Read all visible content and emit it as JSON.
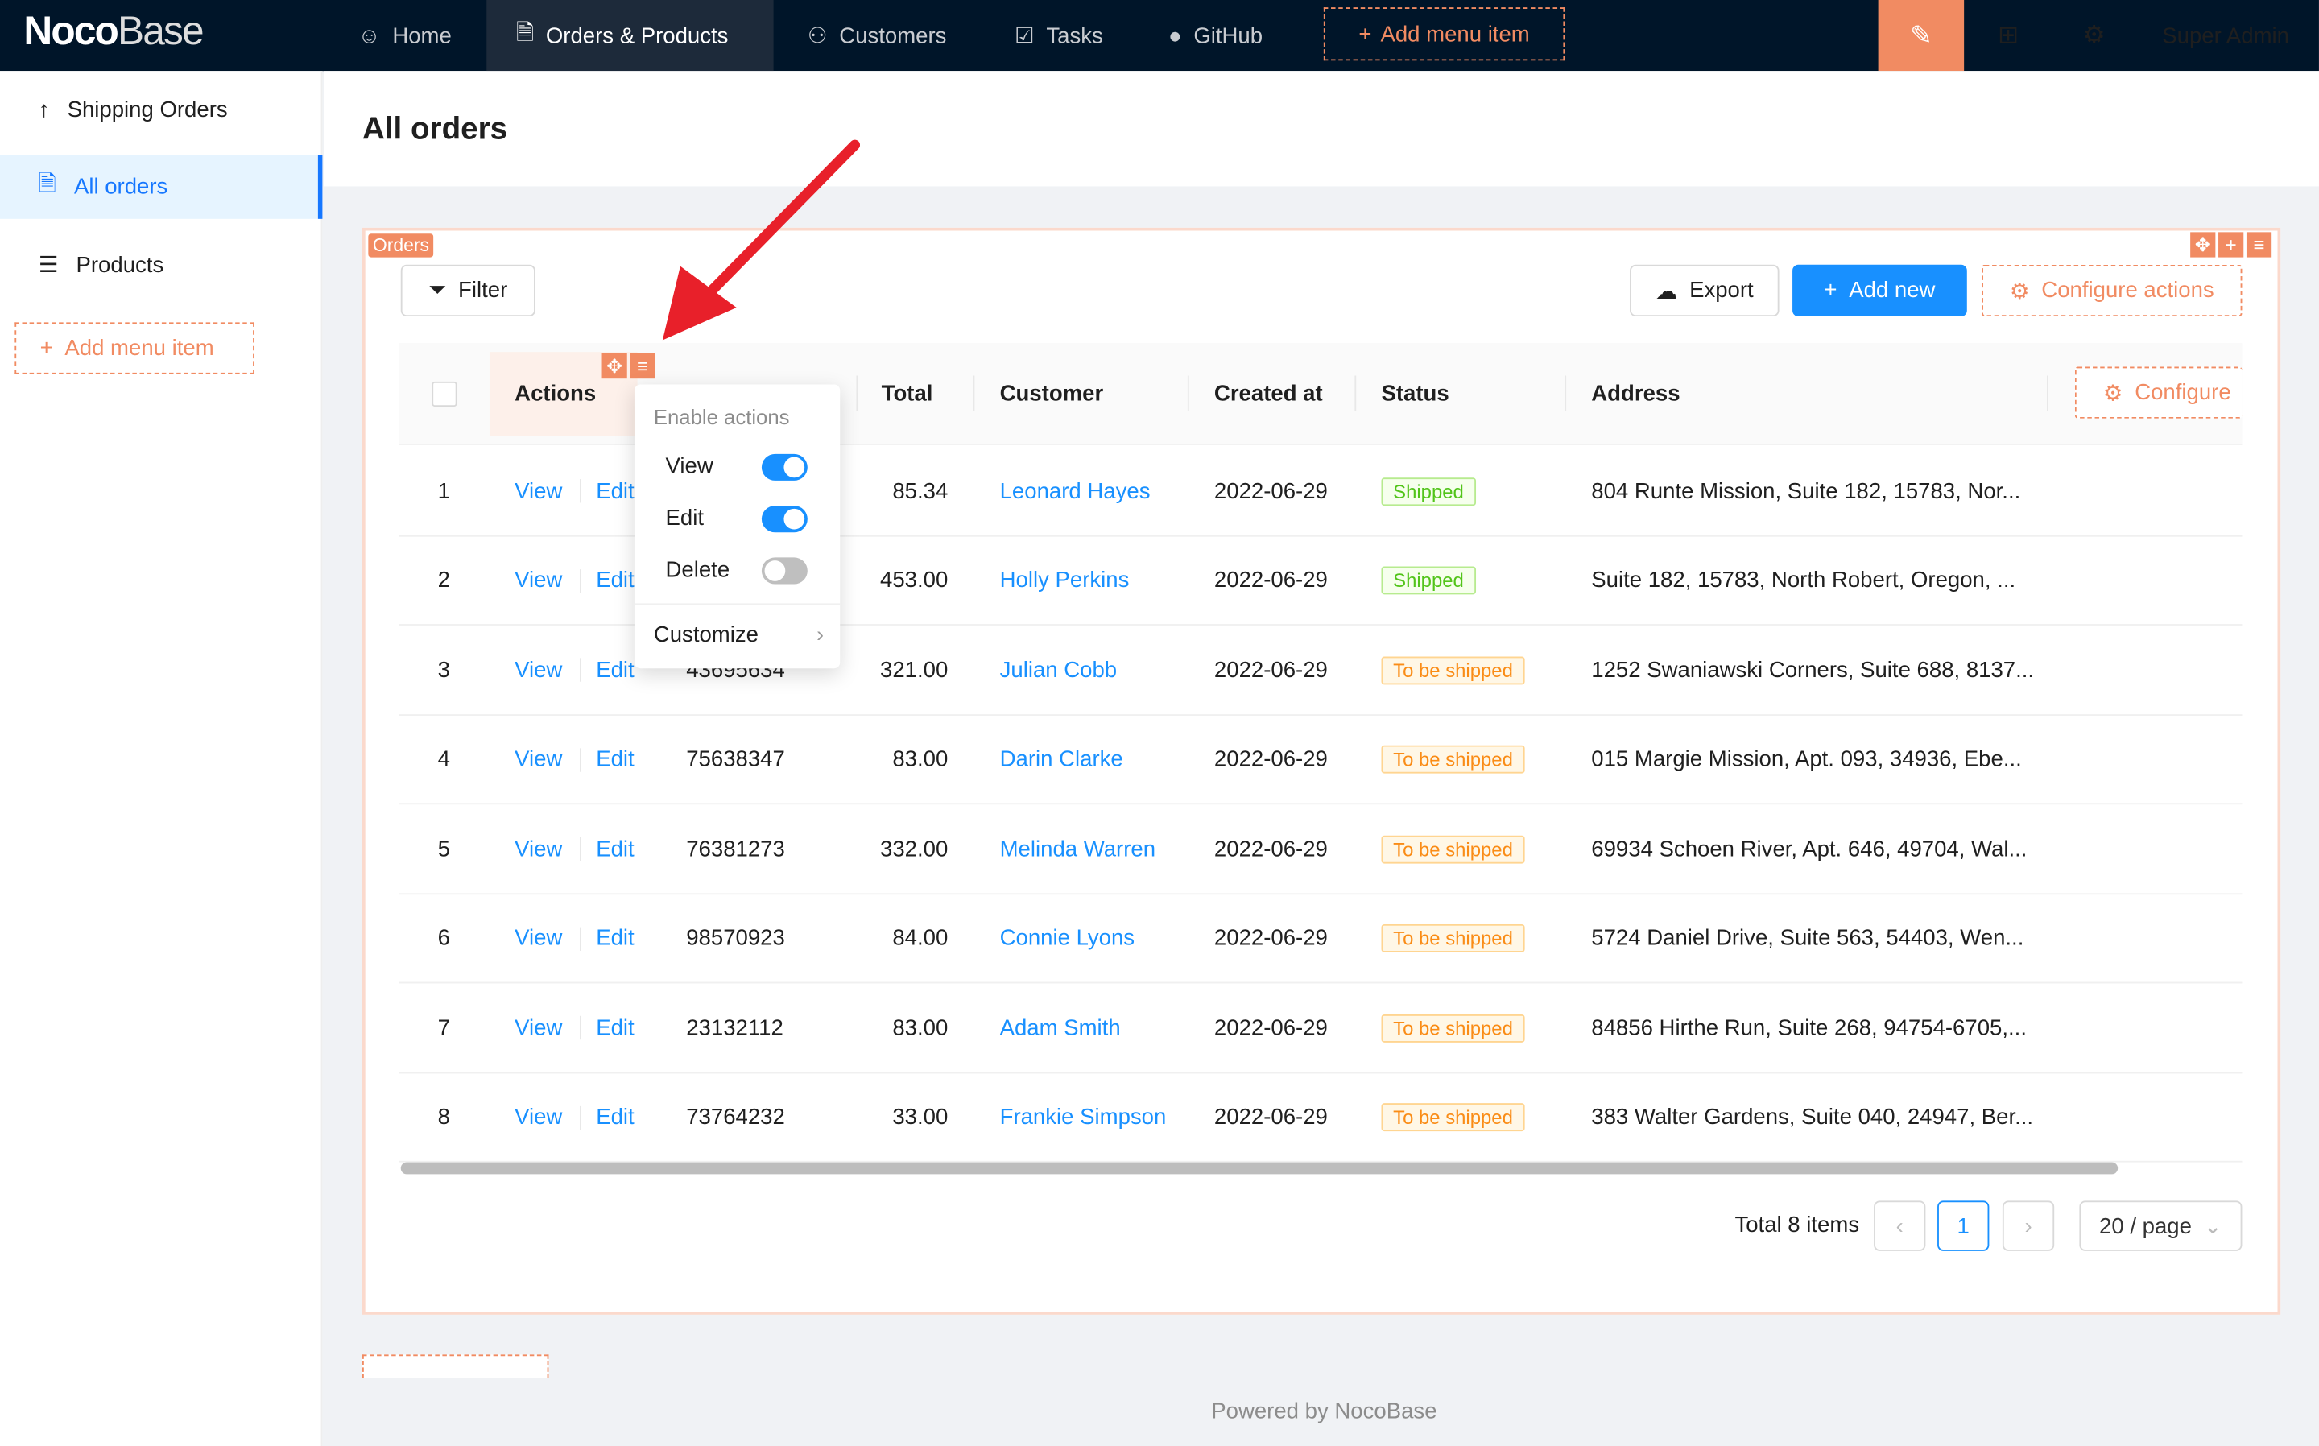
{
  "topbar": {
    "logo_bold": "Noco",
    "logo_light": "Base",
    "nav": [
      {
        "label": "Home",
        "icon": "smile-icon"
      },
      {
        "label": "Orders & Products",
        "icon": "file-check-icon",
        "active": true
      },
      {
        "label": "Customers",
        "icon": "users-icon"
      },
      {
        "label": "Tasks",
        "icon": "checkbox-icon"
      },
      {
        "label": "GitHub",
        "icon": "github-icon"
      }
    ],
    "add_menu_item": "Add menu item",
    "user": "Super Admin"
  },
  "sidebar": {
    "items": [
      {
        "label": "Shipping Orders"
      },
      {
        "label": "All orders",
        "active": true
      },
      {
        "label": "Products"
      }
    ],
    "add_menu_item": "Add menu item"
  },
  "page": {
    "title": "All orders"
  },
  "block": {
    "tag": "Orders",
    "filter": "Filter",
    "export": "Export",
    "add_new": "Add new",
    "configure_actions": "Configure actions",
    "configure_columns": "Configure"
  },
  "table": {
    "headers": {
      "actions": "Actions",
      "total": "Total",
      "customer": "Customer",
      "created": "Created at",
      "status": "Status",
      "address": "Address"
    },
    "rows": [
      {
        "n": "1",
        "view": "View",
        "edit": "Edit",
        "order": "",
        "total": "85.34",
        "customer": "Leonard Hayes",
        "created": "2022-06-29",
        "status": "Shipped",
        "address": "804 Runte Mission, Suite 182, 15783, Nor..."
      },
      {
        "n": "2",
        "view": "View",
        "edit": "Edit",
        "order": "",
        "total": "453.00",
        "customer": "Holly Perkins",
        "created": "2022-06-29",
        "status": "Shipped",
        "address": "Suite 182, 15783, North Robert, Oregon, ..."
      },
      {
        "n": "3",
        "view": "View",
        "edit": "Edit",
        "order": "43695634",
        "total": "321.00",
        "customer": "Julian Cobb",
        "created": "2022-06-29",
        "status": "To be shipped",
        "address": "1252 Swaniawski Corners, Suite 688, 8137..."
      },
      {
        "n": "4",
        "view": "View",
        "edit": "Edit",
        "order": "75638347",
        "total": "83.00",
        "customer": "Darin Clarke",
        "created": "2022-06-29",
        "status": "To be shipped",
        "address": "015 Margie Mission, Apt. 093, 34936, Ebe..."
      },
      {
        "n": "5",
        "view": "View",
        "edit": "Edit",
        "order": "76381273",
        "total": "332.00",
        "customer": "Melinda Warren",
        "created": "2022-06-29",
        "status": "To be shipped",
        "address": "69934 Schoen River, Apt. 646, 49704, Wal..."
      },
      {
        "n": "6",
        "view": "View",
        "edit": "Edit",
        "order": "98570923",
        "total": "84.00",
        "customer": "Connie Lyons",
        "created": "2022-06-29",
        "status": "To be shipped",
        "address": "5724 Daniel Drive, Suite 563, 54403, Wen..."
      },
      {
        "n": "7",
        "view": "View",
        "edit": "Edit",
        "order": "23132112",
        "total": "83.00",
        "customer": "Adam Smith",
        "created": "2022-06-29",
        "status": "To be shipped",
        "address": "84856 Hirthe Run, Suite 268, 94754-6705,..."
      },
      {
        "n": "8",
        "view": "View",
        "edit": "Edit",
        "order": "73764232",
        "total": "33.00",
        "customer": "Frankie Simpson",
        "created": "2022-06-29",
        "status": "To be shipped",
        "address": "383 Walter Gardens, Suite 040, 24947, Ber..."
      }
    ]
  },
  "popup": {
    "heading": "Enable actions",
    "toggles": [
      {
        "label": "View",
        "on": true
      },
      {
        "label": "Edit",
        "on": true
      },
      {
        "label": "Delete",
        "on": false
      }
    ],
    "customize": "Customize"
  },
  "pagination": {
    "total": "Total 8 items",
    "page": "1",
    "page_size": "20 / page"
  },
  "footer": "Powered by NocoBase",
  "colors": {
    "primary": "#1890ff",
    "design_accent": "#f18b62",
    "topbar": "#001529"
  }
}
